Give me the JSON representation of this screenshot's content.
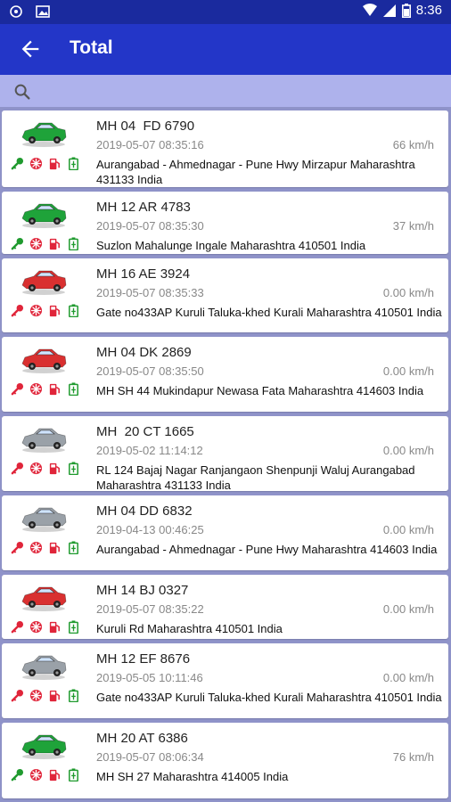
{
  "status": {
    "time": "8:36"
  },
  "header": {
    "title": "Total"
  },
  "vehicles": [
    {
      "plate": "MH 04  FD 6790",
      "time": "2019-05-07 08:35:16",
      "speed": "66 km/h",
      "address": "Aurangabad - Ahmednagar - Pune Hwy Mirzapur Maharashtra 431133 India",
      "car_color": "#1fa33a",
      "key_color": "#1f9a2e"
    },
    {
      "plate": "MH 12 AR 4783",
      "time": "2019-05-07 08:35:30",
      "speed": "37 km/h",
      "address": "Suzlon Mahalunge Ingale Maharashtra 410501 India",
      "car_color": "#1fa33a",
      "key_color": "#1f9a2e"
    },
    {
      "plate": "MH 16 AE 3924",
      "time": "2019-05-07 08:35:33",
      "speed": "0.00 km/h",
      "address": "Gate no433AP Kuruli Taluka-khed Kurali Maharashtra 410501 India",
      "car_color": "#d93030",
      "key_color": "#e0253a"
    },
    {
      "plate": "MH 04 DK 2869",
      "time": "2019-05-07 08:35:50",
      "speed": "0.00 km/h",
      "address": "MH SH 44 Mukindapur Newasa Fata Maharashtra 414603 India",
      "car_color": "#d93030",
      "key_color": "#e0253a"
    },
    {
      "plate": "MH  20 CT 1665",
      "time": "2019-05-02 11:14:12",
      "speed": "0.00 km/h",
      "address": "RL 124 Bajaj Nagar Ranjangaon Shenpunji Waluj Aurangabad Maharashtra 431133 India",
      "car_color": "#9aa1a8",
      "key_color": "#e0253a"
    },
    {
      "plate": "MH 04 DD 6832",
      "time": "2019-04-13 00:46:25",
      "speed": "0.00 km/h",
      "address": "Aurangabad - Ahmednagar - Pune Hwy Maharashtra 414603 India",
      "car_color": "#9aa1a8",
      "key_color": "#e0253a"
    },
    {
      "plate": "MH 14 BJ 0327",
      "time": "2019-05-07 08:35:22",
      "speed": "0.00 km/h",
      "address": "Kuruli Rd Maharashtra 410501 India",
      "car_color": "#d93030",
      "key_color": "#e0253a"
    },
    {
      "plate": "MH 12 EF 8676",
      "time": "2019-05-05 10:11:46",
      "speed": "0.00 km/h",
      "address": "Gate no433AP Kuruli Taluka-khed Kurali Maharashtra 410501 India",
      "car_color": "#9aa1a8",
      "key_color": "#e0253a"
    },
    {
      "plate": "MH 20 AT 6386",
      "time": "2019-05-07 08:06:34",
      "speed": "76 km/h",
      "address": "MH SH 27 Maharashtra 414005 India",
      "car_color": "#1fa33a",
      "key_color": "#1f9a2e"
    }
  ]
}
